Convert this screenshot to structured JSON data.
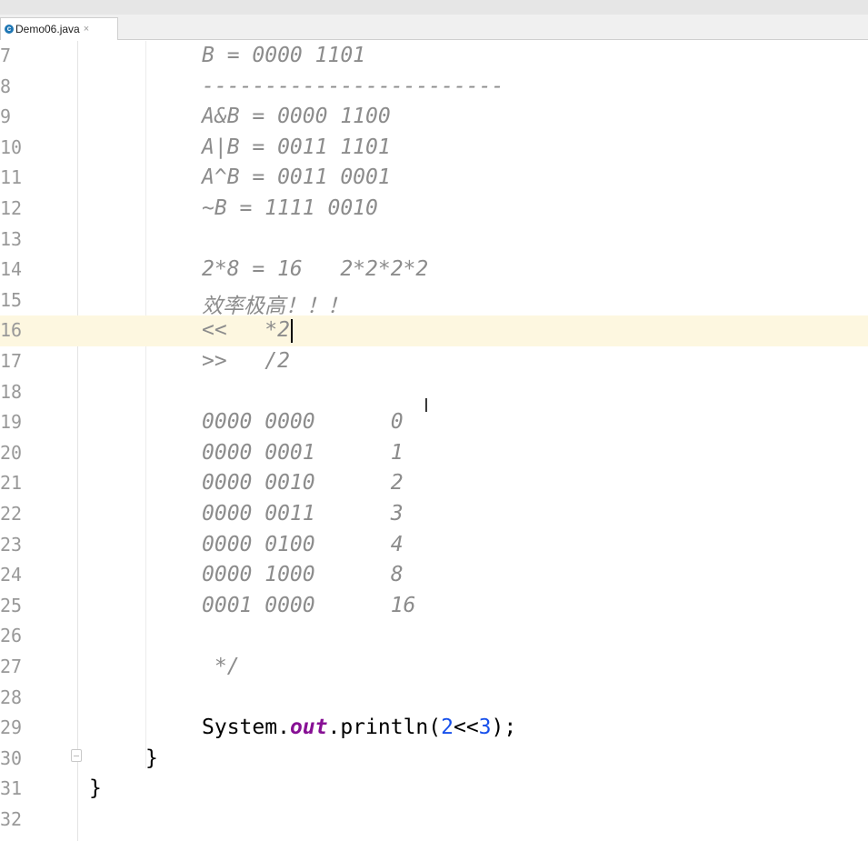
{
  "tab": {
    "icon": "java-class-icon",
    "filename": "Demo06.java",
    "close_glyph": "×"
  },
  "lines": [
    {
      "num": "7",
      "text": "B = 0000 1101"
    },
    {
      "num": "8",
      "text": "------------------------"
    },
    {
      "num": "9",
      "text": "A&B = 0000 1100"
    },
    {
      "num": "10",
      "text": "A|B = 0011 1101"
    },
    {
      "num": "11",
      "text": "A^B = 0011 0001"
    },
    {
      "num": "12",
      "text": "~B = 1111 0010"
    },
    {
      "num": "13",
      "text": ""
    },
    {
      "num": "14",
      "text": "2*8 = 16   2*2*2*2"
    },
    {
      "num": "15",
      "text": "效率极高！！！"
    },
    {
      "num": "16",
      "text": "<<   *2"
    },
    {
      "num": "17",
      "text": ">>   /2"
    },
    {
      "num": "18",
      "text": ""
    },
    {
      "num": "19",
      "text": "0000 0000      0"
    },
    {
      "num": "20",
      "text": "0000 0001      1"
    },
    {
      "num": "21",
      "text": "0000 0010      2"
    },
    {
      "num": "22",
      "text": "0000 0011      3"
    },
    {
      "num": "23",
      "text": "0000 0100      4"
    },
    {
      "num": "24",
      "text": "0000 1000      8"
    },
    {
      "num": "25",
      "text": "0001 0000      16"
    },
    {
      "num": "26",
      "text": ""
    },
    {
      "num": "27",
      "text": " */"
    },
    {
      "num": "28",
      "text": ""
    },
    {
      "num": "29",
      "parts": [
        "System.",
        "out",
        ".println(",
        "2",
        "<<",
        "3",
        ");"
      ]
    },
    {
      "num": "30",
      "text": "}"
    },
    {
      "num": "31",
      "text": "}"
    },
    {
      "num": "32",
      "text": ""
    }
  ],
  "colors": {
    "current_line_bg": "#fdf7e0",
    "comment": "#8c8c8c",
    "number": "#1750eb",
    "field": "#871094"
  }
}
